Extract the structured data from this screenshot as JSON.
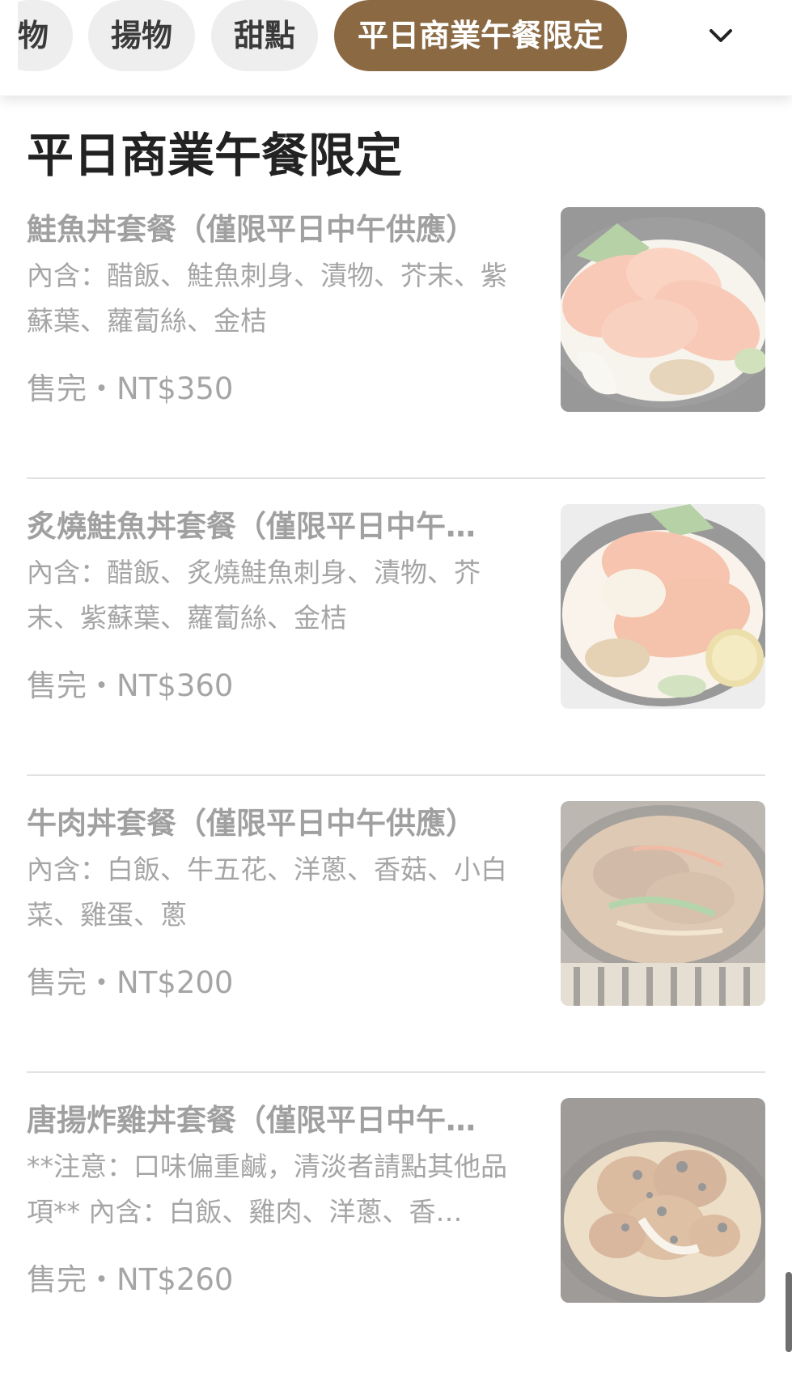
{
  "tabs": [
    {
      "label": "物",
      "active": false
    },
    {
      "label": "揚物",
      "active": false
    },
    {
      "label": "甜點",
      "active": false
    },
    {
      "label": "平日商業午餐限定",
      "active": true
    }
  ],
  "section_title": "平日商業午餐限定",
  "items": [
    {
      "name": "鮭魚丼套餐（僅限平日中午供應）",
      "description": "內含：醋飯、鮭魚刺身、漬物、芥末、紫蘇葉、蘿蔔絲、金桔",
      "price": "售完・NT$350",
      "image": "salmon-don-photo"
    },
    {
      "name": "炙燒鮭魚丼套餐（僅限平日中午…",
      "description": "內含：醋飯、炙燒鮭魚刺身、漬物、芥末、紫蘇葉、蘿蔔絲、金桔",
      "price": "售完・NT$360",
      "image": "seared-salmon-don-photo"
    },
    {
      "name": "牛肉丼套餐（僅限平日中午供應）",
      "description": "內含：白飯、牛五花、洋蔥、香菇、小白菜、雞蛋、蔥",
      "price": "售完・NT$200",
      "image": "beef-don-photo"
    },
    {
      "name": "唐揚炸雞丼套餐（僅限平日中午…",
      "description": "**注意：口味偏重鹹，清淡者請點其他品項** 內含：白飯、雞肉、洋蔥、香…",
      "price": "售完・NT$260",
      "image": "karaage-don-photo"
    }
  ],
  "icons": {
    "dropdown": "chevron-down-icon"
  },
  "colors": {
    "active_tab": "#8b6a43",
    "inactive_tab": "#eeeeee"
  }
}
